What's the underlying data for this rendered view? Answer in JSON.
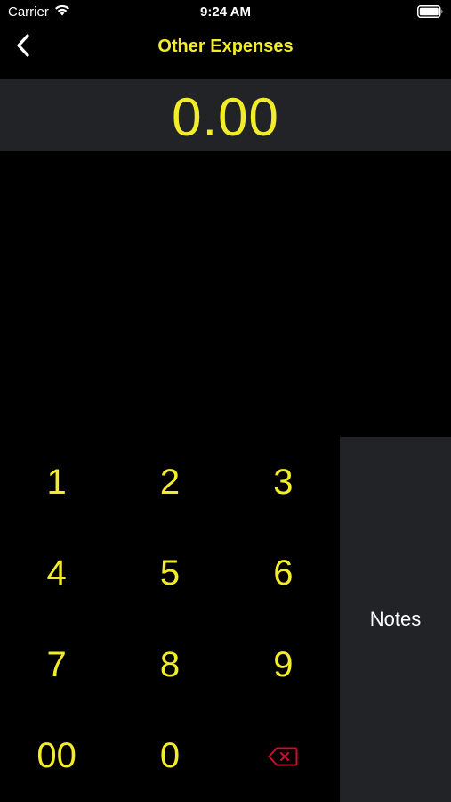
{
  "status_bar": {
    "carrier": "Carrier",
    "time": "9:24 AM",
    "icons": [
      "wifi-icon",
      "battery-icon"
    ]
  },
  "nav": {
    "back_icon": "chevron-left-icon",
    "title": "Other Expenses"
  },
  "amount": {
    "value": "0.00"
  },
  "keypad": {
    "keys": [
      "1",
      "2",
      "3",
      "4",
      "5",
      "6",
      "7",
      "8",
      "9",
      "00",
      "0"
    ],
    "backspace_icon": "backspace-icon"
  },
  "notes": {
    "label": "Notes"
  },
  "colors": {
    "accent": "#f2ec2a",
    "panel": "#222326",
    "background": "#000000",
    "backspace": "#c8102e"
  }
}
